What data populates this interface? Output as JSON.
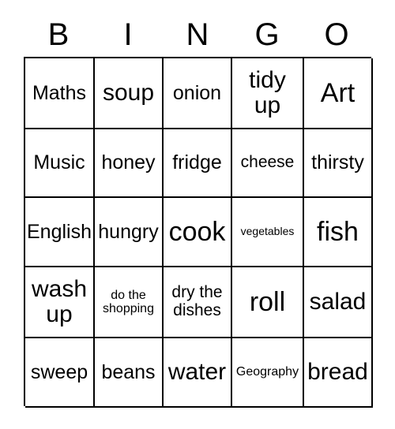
{
  "card": {
    "type": "bingo-card",
    "columns": 5,
    "rows": 5,
    "border_color": "#000000",
    "background_color": "#ffffff",
    "text_color": "#000000"
  },
  "header": {
    "letters": [
      "B",
      "I",
      "N",
      "G",
      "O"
    ]
  },
  "grid": {
    "rows": [
      {
        "cells": [
          {
            "text": "Maths",
            "size": "md"
          },
          {
            "text": "soup",
            "size": "lg"
          },
          {
            "text": "onion",
            "size": "md"
          },
          {
            "text": "tidy\nup",
            "size": "lg"
          },
          {
            "text": "Art",
            "size": "xl"
          }
        ]
      },
      {
        "cells": [
          {
            "text": "Music",
            "size": "md"
          },
          {
            "text": "honey",
            "size": "md"
          },
          {
            "text": "fridge",
            "size": "md"
          },
          {
            "text": "cheese",
            "size": "sm"
          },
          {
            "text": "thirsty",
            "size": "md"
          }
        ]
      },
      {
        "cells": [
          {
            "text": "English",
            "size": "md"
          },
          {
            "text": "hungry",
            "size": "md"
          },
          {
            "text": "cook",
            "size": "xl"
          },
          {
            "text": "vegetables",
            "size": "xxs"
          },
          {
            "text": "fish",
            "size": "xl"
          }
        ]
      },
      {
        "cells": [
          {
            "text": "wash\nup",
            "size": "lg"
          },
          {
            "text": "do the\nshopping",
            "size": "xs"
          },
          {
            "text": "dry the\ndishes",
            "size": "sm"
          },
          {
            "text": "roll",
            "size": "xl"
          },
          {
            "text": "salad",
            "size": "lg"
          }
        ]
      },
      {
        "cells": [
          {
            "text": "sweep",
            "size": "md"
          },
          {
            "text": "beans",
            "size": "md"
          },
          {
            "text": "water",
            "size": "lg"
          },
          {
            "text": "Geography",
            "size": "xs"
          },
          {
            "text": "bread",
            "size": "lg"
          }
        ]
      }
    ]
  }
}
